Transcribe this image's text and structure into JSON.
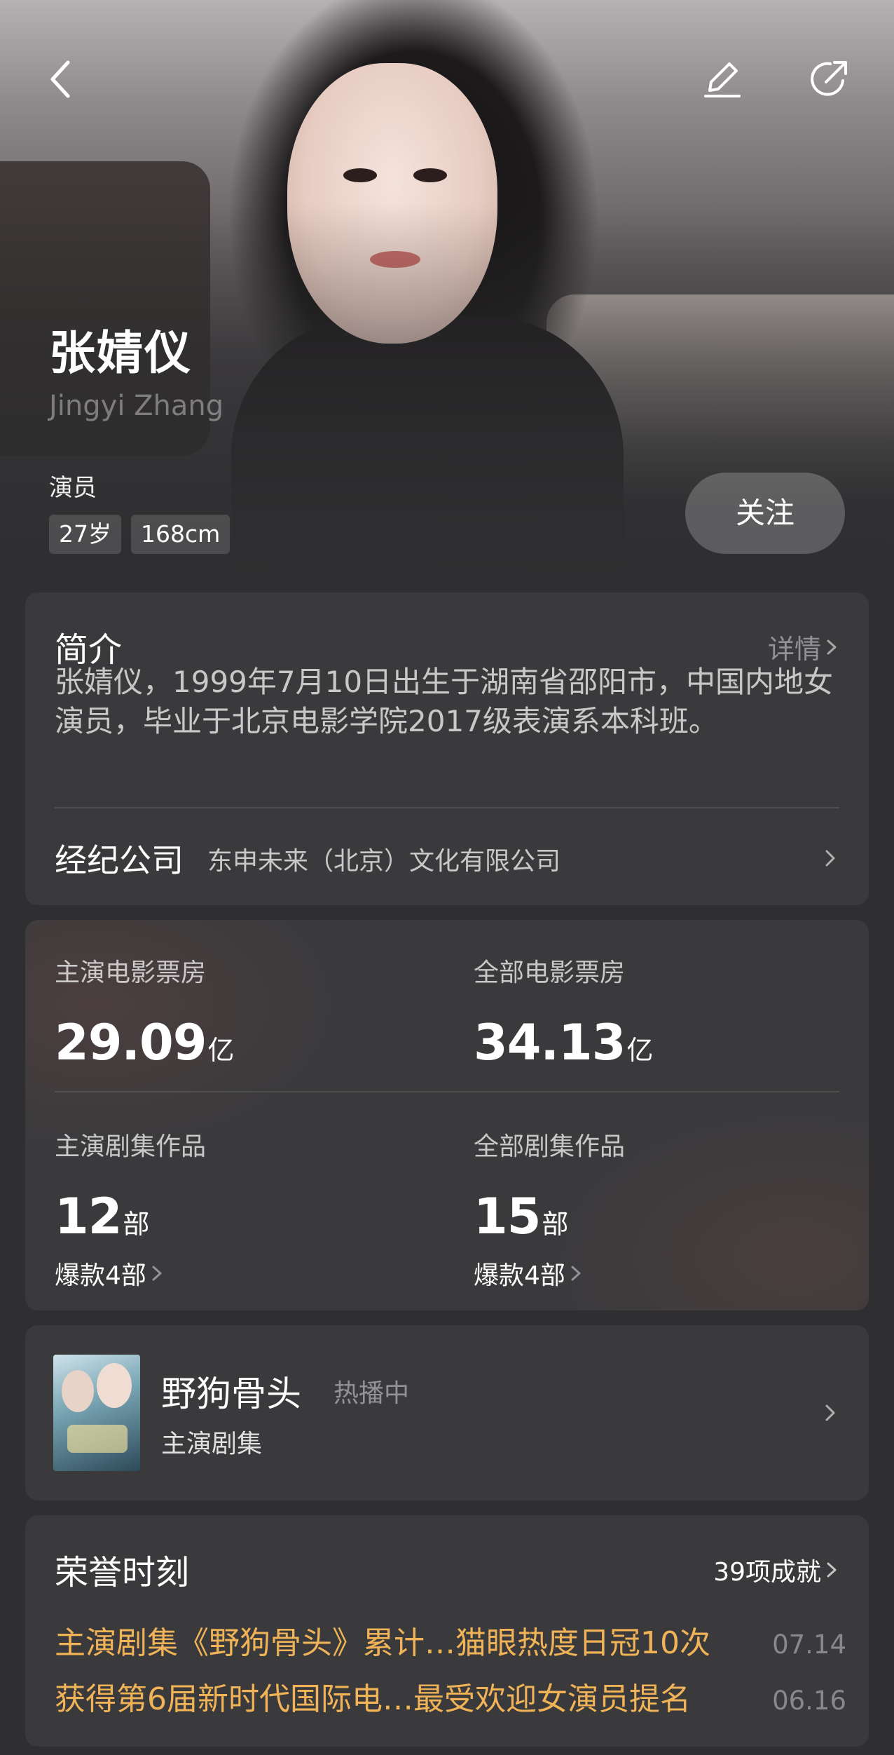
{
  "header": {
    "back_icon": "chevron-left-icon",
    "edit_icon": "pencil-icon",
    "share_icon": "share-arrow-icon"
  },
  "profile": {
    "name": "张婧仪",
    "english_name": "Jingyi Zhang",
    "role": "演员",
    "age": "27岁",
    "height": "168cm",
    "follow_label": "关注"
  },
  "intro": {
    "title": "简介",
    "more_label": "详情",
    "text": "张婧仪，1999年7月10日出生于湖南省邵阳市，中国内地女演员，毕业于北京电影学院2017级表演系本科班。",
    "agency_label": "经纪公司",
    "agency_value": "东申未来（北京）文化有限公司"
  },
  "stats": {
    "lead_box_office": {
      "label": "主演电影票房",
      "value": "29.09",
      "unit": "亿"
    },
    "all_box_office": {
      "label": "全部电影票房",
      "value": "34.13",
      "unit": "亿"
    },
    "lead_series": {
      "label": "主演剧集作品",
      "value": "12",
      "unit": "部",
      "hits": "爆款4部"
    },
    "all_series": {
      "label": "全部剧集作品",
      "value": "15",
      "unit": "部",
      "hits": "爆款4部"
    }
  },
  "drama": {
    "title": "野狗骨头",
    "status": "热播中",
    "role": "主演剧集"
  },
  "honors": {
    "title": "荣誉时刻",
    "count_label": "39项成就",
    "items": [
      {
        "text": "主演剧集《野狗骨头》累计…猫眼热度日冠10次",
        "date": "07.14"
      },
      {
        "text": "获得第6届新时代国际电…最受欢迎女演员提名",
        "date": "06.16"
      }
    ]
  },
  "colors": {
    "background": "#2f2f31",
    "card": "#3a3a3c",
    "honor_text": "#f0b357"
  }
}
